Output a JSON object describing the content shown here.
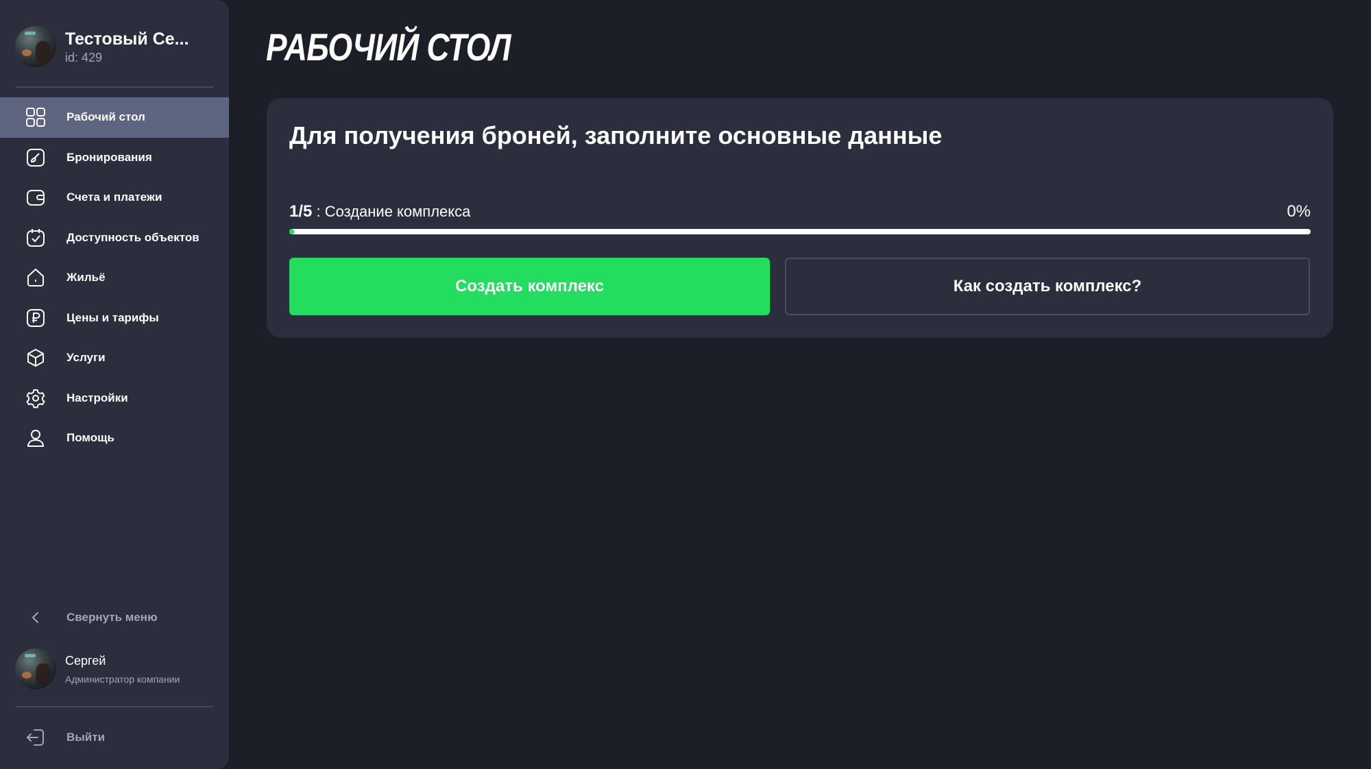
{
  "sidebar": {
    "company": {
      "name": "Тестовый Се...",
      "id": "id: 429"
    },
    "items": [
      {
        "label": "Рабочий стол",
        "icon": "dashboard-grid-icon",
        "active": true
      },
      {
        "label": "Бронирования",
        "icon": "booking-brush-icon"
      },
      {
        "label": "Счета и платежи",
        "icon": "wallet-icon"
      },
      {
        "label": "Доступность объектов",
        "icon": "calendar-check-icon"
      },
      {
        "label": "Жильё",
        "icon": "home-icon"
      },
      {
        "label": "Цены и тарифы",
        "icon": "ruble-icon"
      },
      {
        "label": "Услуги",
        "icon": "box-icon"
      },
      {
        "label": "Настройки",
        "icon": "gear-icon"
      },
      {
        "label": "Помощь",
        "icon": "user-help-icon"
      }
    ],
    "collapse_label": "Свернуть меню",
    "user": {
      "name": "Сергей",
      "role": "Администратор компании"
    },
    "logout_label": "Выйти"
  },
  "main": {
    "title": "Рабочий стол",
    "card": {
      "heading": "Для получения броней, заполните основные данные",
      "step": {
        "count": "1/5",
        "separator": " : ",
        "name": "Создание комплекса"
      },
      "percent_label": "0%",
      "progress_fraction": 0,
      "primary_button": "Создать комплекс",
      "secondary_button": "Как создать комплекс?"
    }
  },
  "colors": {
    "background": "#1c1e28",
    "sidebar": "#2c2e3d",
    "active_item": "#5d6580",
    "accent_green": "#22dd5e",
    "muted_text": "#a3a6b4"
  }
}
